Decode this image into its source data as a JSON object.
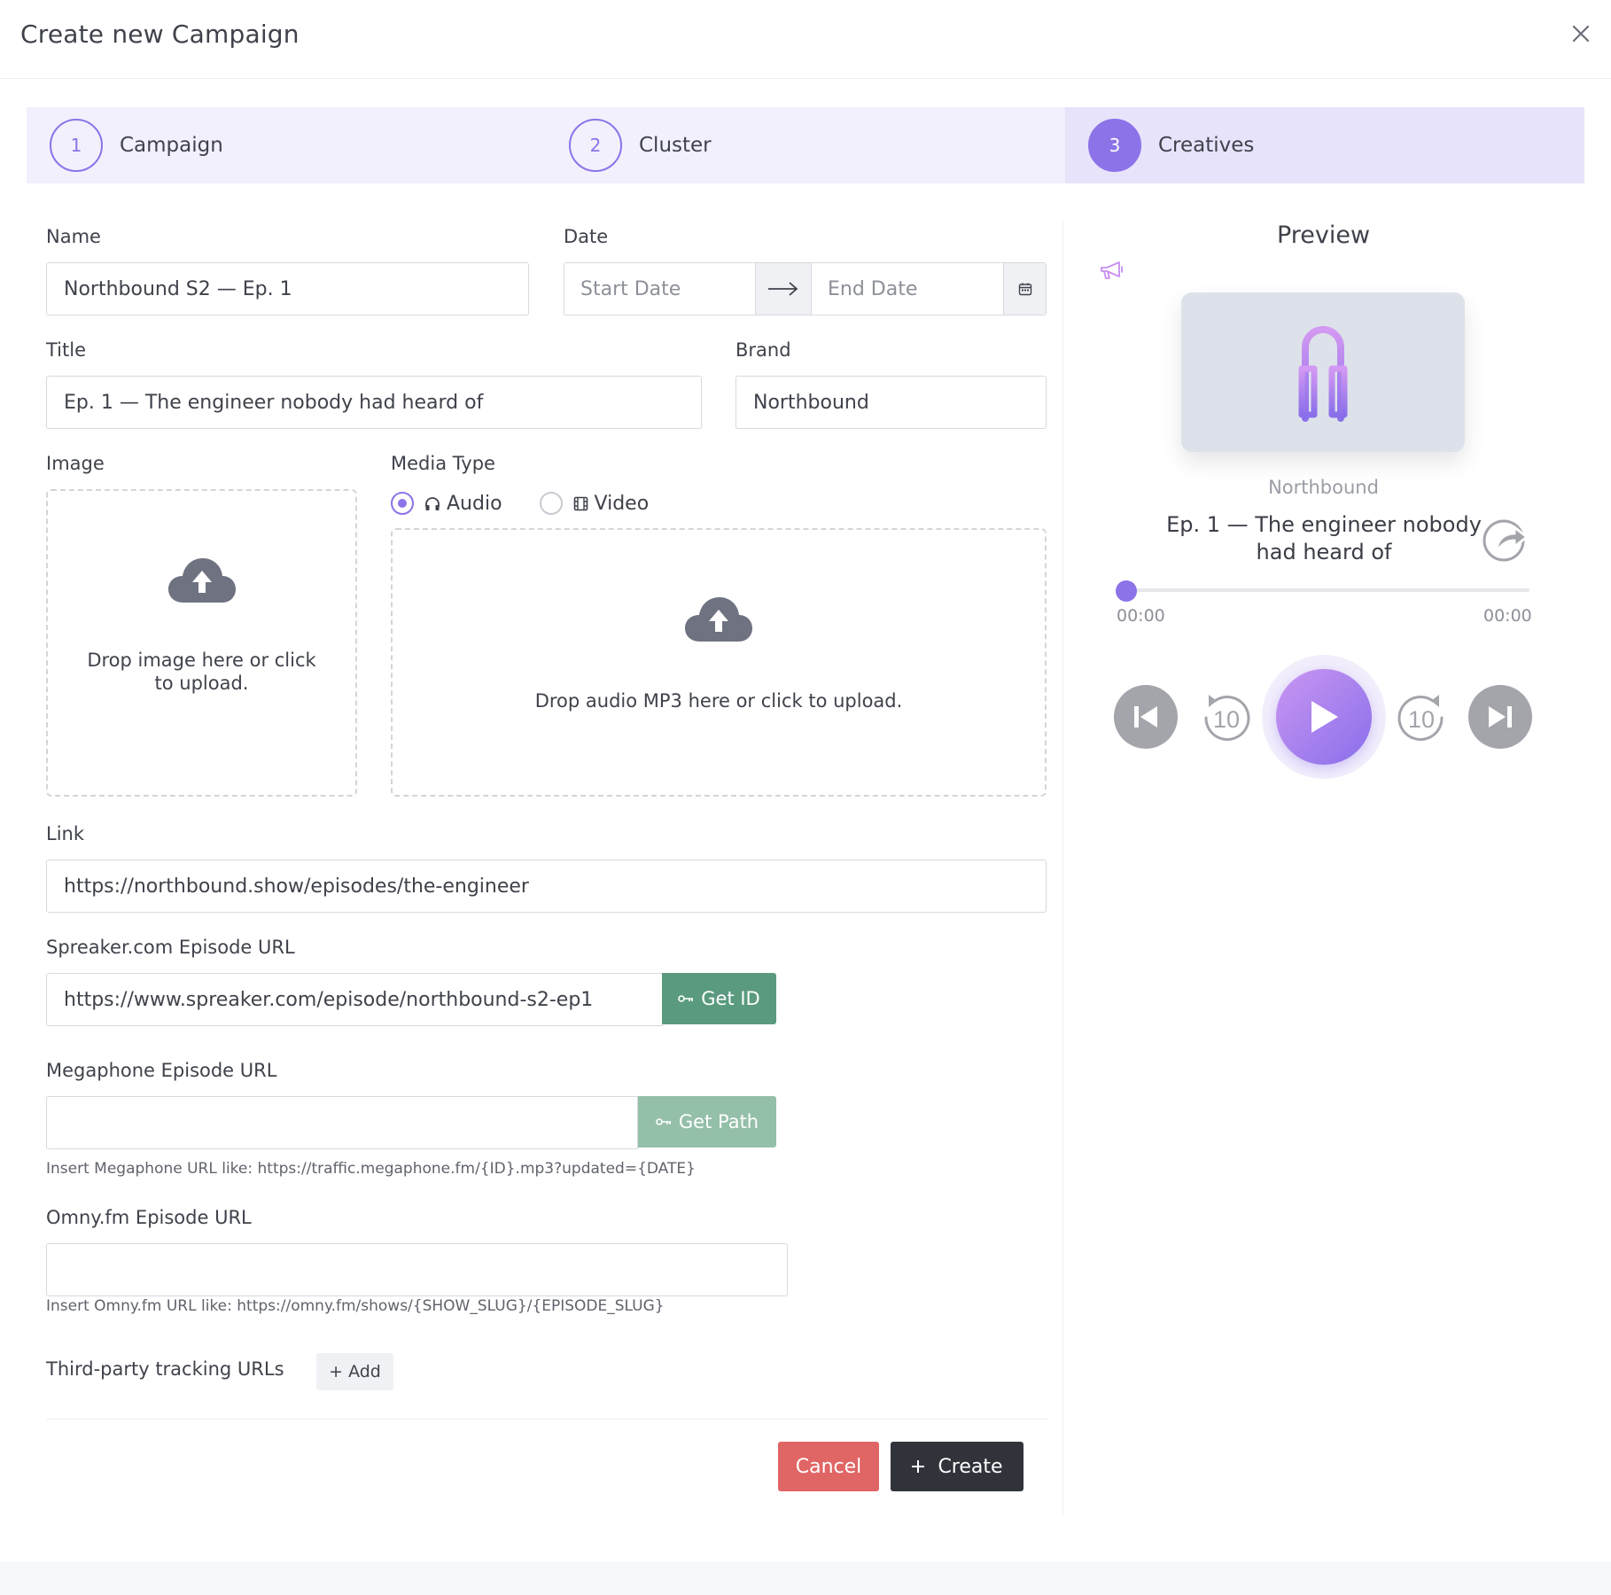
{
  "modal": {
    "title": "Create new Campaign"
  },
  "stepper": {
    "steps": [
      {
        "number": "1",
        "label": "Campaign"
      },
      {
        "number": "2",
        "label": "Cluster"
      },
      {
        "number": "3",
        "label": "Creatives"
      }
    ],
    "active_step": 3
  },
  "form": {
    "name": {
      "label": "Name",
      "value": "Northbound S2 — Ep. 1"
    },
    "date": {
      "label": "Date",
      "start_placeholder": "Start Date",
      "end_placeholder": "End Date"
    },
    "title": {
      "label": "Title",
      "value": "Ep. 1 — The engineer nobody had heard of"
    },
    "brand": {
      "label": "Brand",
      "value": "Northbound"
    },
    "image": {
      "label": "Image",
      "drop_text": "Drop image here or click to upload."
    },
    "media_type": {
      "label": "Media Type",
      "options": [
        {
          "label": "Audio",
          "icon": "headphones-icon"
        },
        {
          "label": "Video",
          "icon": "film-icon"
        }
      ],
      "selected": "Audio",
      "drop_text": "Drop audio MP3 here or click to upload."
    },
    "link": {
      "label": "Link",
      "value": "https://northbound.show/episodes/the-engineer"
    },
    "spreaker": {
      "label": "Spreaker.com Episode URL",
      "value": "https://www.spreaker.com/episode/northbound-s2-ep1",
      "button": "Get ID"
    },
    "megaphone": {
      "label": "Megaphone Episode URL",
      "value": "",
      "button": "Get Path",
      "hint": "Insert Megaphone URL like: https://traffic.megaphone.fm/{ID}.mp3?updated={DATE}"
    },
    "omny": {
      "label": "Omny.fm Episode URL",
      "value": "",
      "hint": "Insert Omny.fm URL like: https://omny.fm/shows/{SHOW_SLUG}/{EPISODE_SLUG}"
    },
    "tracking": {
      "label": "Third-party tracking URLs",
      "add_button": "+ Add"
    }
  },
  "footer": {
    "cancel": "Cancel",
    "create": "Create"
  },
  "preview": {
    "title": "Preview",
    "brand": "Northbound",
    "episode_title": "Ep. 1 — The engineer nobody had heard of",
    "current_time": "00:00",
    "duration": "00:00",
    "progress": 0,
    "skip_back_seconds": "10",
    "skip_forward_seconds": "10"
  },
  "colors": {
    "accent": "#8c73e8",
    "accent_light": "#f2f0fd",
    "green": "#5a9a7f",
    "cancel_red": "#e06565",
    "dark_button": "#30333a"
  }
}
